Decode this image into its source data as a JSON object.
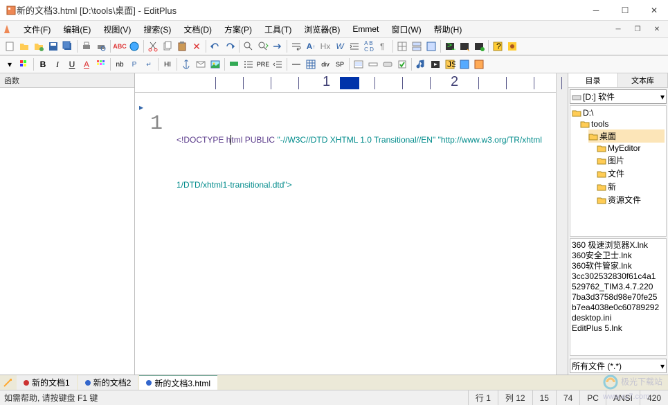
{
  "window": {
    "title": "新的文档3.html [D:\\tools\\桌面] - EditPlus"
  },
  "menu": {
    "items": [
      "文件(F)",
      "编辑(E)",
      "视图(V)",
      "搜索(S)",
      "文档(D)",
      "方案(P)",
      "工具(T)",
      "浏览器(B)",
      "Emmet",
      "窗口(W)",
      "帮助(H)"
    ]
  },
  "left_panel": {
    "title": "函数"
  },
  "ruler": {
    "marks": [
      "1",
      "2"
    ]
  },
  "editor": {
    "line_numbers": [
      "1"
    ],
    "first_line_tokens": {
      "open": "<!",
      "doctype": "DOCTYPE",
      "html": "h",
      "html2": "tml",
      "public": "PUBLIC"
    },
    "rest": "\"-//W3C//DTD XHTML 1.0 Transitional//EN\" \"http://www.w3.org/TR/xhtml1/DTD/xhtml1-transitional.dtd\">"
  },
  "right_panel": {
    "tabs": [
      "目录",
      "文本库"
    ],
    "drive": "[D:] 软件",
    "tree": [
      {
        "label": "D:\\",
        "indent": 0
      },
      {
        "label": "tools",
        "indent": 1
      },
      {
        "label": "桌面",
        "indent": 2,
        "selected": true
      },
      {
        "label": "MyEditor",
        "indent": 3
      },
      {
        "label": "图片",
        "indent": 3
      },
      {
        "label": "文件",
        "indent": 3
      },
      {
        "label": "新",
        "indent": 3
      },
      {
        "label": "资源文件",
        "indent": 3
      }
    ],
    "files": [
      "360 极速浏览器X.lnk",
      "360安全卫士.lnk",
      "360软件管家.lnk",
      "3cc302532830f61c4a1",
      "529762_TIM3.4.7.220",
      "7ba3d3758d98e70fe25",
      "b7ea4038e0c60789292",
      "desktop.ini",
      "EditPlus 5.lnk"
    ],
    "filter": "所有文件 (*.*)"
  },
  "tabs": {
    "items": [
      {
        "label": "新的文档1",
        "color": "#cc3333",
        "active": false
      },
      {
        "label": "新的文档2",
        "color": "#3366cc",
        "active": false
      },
      {
        "label": "新的文档3.html",
        "color": "#3366cc",
        "active": true
      }
    ]
  },
  "status": {
    "hint": "如需帮助, 请按键盘 F1 键",
    "line": "行 1",
    "col": "列 12",
    "num1": "15",
    "num2": "74",
    "pc": "PC",
    "encoding": "ANSI",
    "last": "420"
  },
  "footer": {
    "brand": "极光下载站",
    "url": "www.xz7.com"
  }
}
